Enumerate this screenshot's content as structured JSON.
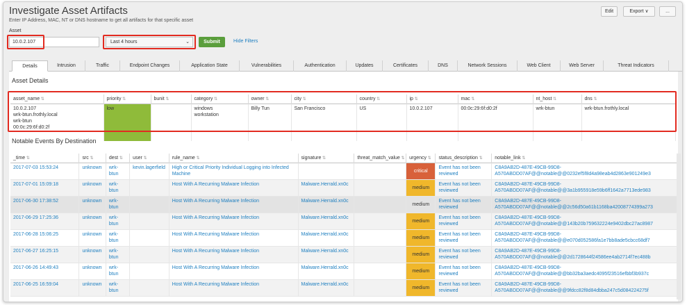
{
  "page": {
    "title": "Investigate Asset Artifacts",
    "subtitle": "Enter IP Address, MAC, NT or DNS hostname to get all artifacts for that specific asset",
    "edit_label": "Edit",
    "export_label": "Export ∨",
    "more_label": "..."
  },
  "filters": {
    "asset_label": "Asset",
    "asset_value": "10.0.2.107",
    "time_value": "Last 4 hours",
    "submit_label": "Submit",
    "hide_filters_label": "Hide Filters"
  },
  "tabs": [
    {
      "label": "Details",
      "active": true
    },
    {
      "label": "Intrusion"
    },
    {
      "label": "Traffic"
    },
    {
      "label": "Endpoint Changes"
    },
    {
      "label": "Application State"
    },
    {
      "label": "Vulnerabilities"
    },
    {
      "label": "Authentication"
    },
    {
      "label": "Updates"
    },
    {
      "label": "Certificates"
    },
    {
      "label": "DNS"
    },
    {
      "label": "Network Sessions"
    },
    {
      "label": "Web Client"
    },
    {
      "label": "Web Server"
    },
    {
      "label": "Threat Indicators"
    }
  ],
  "asset_details": {
    "title": "Asset Details",
    "columns": [
      "asset_name",
      "priority",
      "bunit",
      "category",
      "owner",
      "city",
      "country",
      "ip",
      "mac",
      "nt_host",
      "dns"
    ],
    "row": {
      "asset_name": [
        "10.0.2.107",
        "wrk-btun.frothly.local",
        "wrk-btun",
        "00:0c:29:6f:d0:2f"
      ],
      "priority": "low",
      "bunit": "",
      "category": [
        "windows",
        "workstation"
      ],
      "owner": "Billy Tun",
      "city": "San Francisco",
      "country": "US",
      "ip": "10.0.2.107",
      "mac": "00:0c:29:6f:d0:2f",
      "nt_host": "wrk-btun",
      "dns": "wrk-btun.frothly.local"
    },
    "priority_color": "#8fbb3a"
  },
  "notable": {
    "title": "Notable Events By Destination",
    "columns": [
      "_time",
      "src",
      "dest",
      "user",
      "rule_name",
      "signature",
      "threat_match_value",
      "urgency",
      "status_description",
      "notable_link"
    ],
    "rows": [
      {
        "time": "2017-07-03 15:53:24",
        "src": "unknown",
        "dest": "wrk-btun",
        "user": "kevin.lagerfield",
        "rule_name": "High or Critical Priority Individual Logging into Infected Machine",
        "signature": "",
        "threat": "",
        "urgency": "critical",
        "status": "Event has not been reviewed",
        "link1": "C8A9AB2D-487E-49CB-99D8-",
        "link2": "A570ABDD07AF@@notable@@0232ef5f8d4a98eab4d2863e901249e3"
      },
      {
        "time": "2017-07-01 15:09:18",
        "src": "unknown",
        "dest": "wrk-btun",
        "user": "",
        "rule_name": "Host With A Recurring Malware Infection",
        "signature": "Malware.Herrald.xn0c",
        "threat": "",
        "urgency": "medium",
        "status": "Event has not been reviewed",
        "link1": "C8A9AB2D-487E-49CB-99D8-",
        "link2": "A570ABDD07AF@@notable@@3a1b955918e59b6ff1642a7713ede983"
      },
      {
        "time": "2017-06-30 17:38:52",
        "src": "unknown",
        "dest": "wrk-btun",
        "user": "",
        "rule_name": "Host With A Recurring Malware Infection",
        "signature": "Malware.Herrald.xn0c",
        "threat": "",
        "urgency": "medium",
        "status": "Event has not been reviewed",
        "link1": "C8A9AB2D-487E-49CB-99D8-",
        "link2": "A570ABDD07AF@@notable@@2c56d50a61b1168ba42008774399a273"
      },
      {
        "time": "2017-06-29 17:25:36",
        "src": "unknown",
        "dest": "wrk-btun",
        "user": "",
        "rule_name": "Host With A Recurring Malware Infection",
        "signature": "Malware.Herrald.xn0c",
        "threat": "",
        "urgency": "medium",
        "status": "Event has not been reviewed",
        "link1": "C8A9AB2D-487E-49CB-99D8-",
        "link2": "A570ABDD07AF@@notable@@143b20b759632224e9402dbc27ac8987"
      },
      {
        "time": "2017-06-28 15:06:25",
        "src": "unknown",
        "dest": "wrk-btun",
        "user": "",
        "rule_name": "Host With A Recurring Malware Infection",
        "signature": "Malware.Herrald.xn0c",
        "threat": "",
        "urgency": "medium",
        "status": "Event has not been reviewed",
        "link1": "C8A9AB2D-487E-49CB-99D8-",
        "link2": "A570ABDD07AF@@notable@@e070d052586fa1e7bb8ade5cbcc68df7"
      },
      {
        "time": "2017-06-27 16:25:15",
        "src": "unknown",
        "dest": "wrk-btun",
        "user": "",
        "rule_name": "Host With A Recurring Malware Infection",
        "signature": "Malware.Herrald.xn0c",
        "threat": "",
        "urgency": "medium",
        "status": "Event has not been reviewed",
        "link1": "C8A9AB2D-487E-49CB-99D8-",
        "link2": "A570ABDD07AF@@notable@@2d1728644f24586ee4ab2714f7ec488b"
      },
      {
        "time": "2017-06-26 14:49:43",
        "src": "unknown",
        "dest": "wrk-btun",
        "user": "",
        "rule_name": "Host With A Recurring Malware Infection",
        "signature": "Malware.Herrald.xn0c",
        "threat": "",
        "urgency": "medium",
        "status": "Event has not been reviewed",
        "link1": "C8A9AB2D-487E-49CB-99D8-",
        "link2": "A570ABDD07AF@@notable@@bb32ba3aedc4095f23516efbbf3b937c"
      },
      {
        "time": "2017-06-25 16:59:04",
        "src": "unknown",
        "dest": "wrk-btun",
        "user": "",
        "rule_name": "Host With A Recurring Malware Infection",
        "signature": "Malware.Herrald.xn0c",
        "threat": "",
        "urgency": "medium",
        "status": "Event has not been reviewed",
        "link1": "C8A9AB2D-487E-49CB-99D8-",
        "link2": "A570ABDD07AF@@notable@@9fdcc82f8d84dbba247c5d084224275f"
      }
    ]
  },
  "colors": {
    "accent_link": "#1e7fc0",
    "submit": "#5a9e3c",
    "highlight_box": "#e22a20",
    "urgency_medium": "#f0b72b",
    "urgency_critical": "#d8613a"
  }
}
